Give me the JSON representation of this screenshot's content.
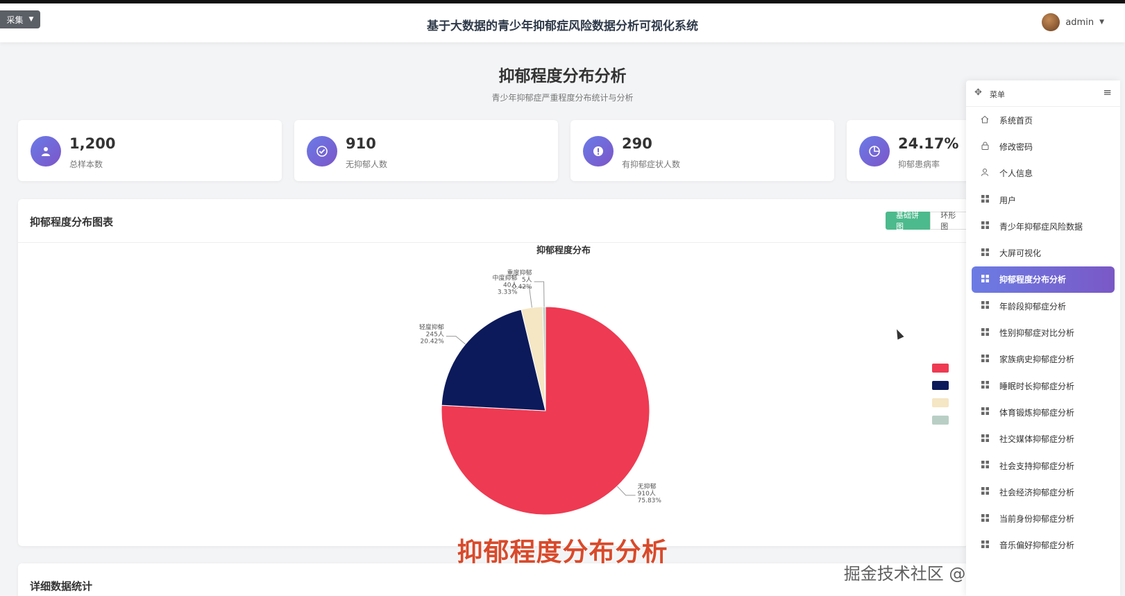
{
  "header": {
    "collect_label": "采集",
    "title": "基于大数据的青少年抑郁症风险数据分析可视化系统",
    "username": "admin"
  },
  "page": {
    "title": "抑郁程度分布分析",
    "subtitle": "青少年抑郁症严重程度分布统计与分析"
  },
  "stats": [
    {
      "value": "1,200",
      "label": "总样本数",
      "icon": "user-icon"
    },
    {
      "value": "910",
      "label": "无抑郁人数",
      "icon": "check-icon"
    },
    {
      "value": "290",
      "label": "有抑郁症状人数",
      "icon": "alert-icon"
    },
    {
      "value": "24.17%",
      "label": "抑郁患病率",
      "icon": "pie-icon"
    }
  ],
  "chart_panel": {
    "title": "抑郁程度分布图表",
    "tabs": [
      "基础饼图",
      "环形图"
    ],
    "active_tab": "基础饼图"
  },
  "chart_data": {
    "type": "pie",
    "title": "抑郁程度分布",
    "slices": [
      {
        "name": "无抑郁",
        "count_label": "910人",
        "percent_label": "75.83%",
        "value": 910,
        "color": "#ee3a52"
      },
      {
        "name": "轻度抑郁",
        "count_label": "245人",
        "percent_label": "20.42%",
        "value": 245,
        "color": "#0c1a5b"
      },
      {
        "name": "中度抑郁",
        "count_label": "40人",
        "percent_label": "3.33%",
        "value": 40,
        "color": "#f5e6c4"
      },
      {
        "name": "重度抑郁",
        "count_label": "5人",
        "percent_label": "0.42%",
        "value": 5,
        "color": "#b9cfc5"
      }
    ]
  },
  "detail_panel": {
    "title": "详细数据统计"
  },
  "caption": "抑郁程度分布分析",
  "watermark": "掘金技术社区 @ 计算机编程指导师",
  "menu": {
    "title": "菜单",
    "items": [
      {
        "label": "系统首页",
        "icon": "home-icon"
      },
      {
        "label": "修改密码",
        "icon": "lock-icon"
      },
      {
        "label": "个人信息",
        "icon": "person-icon"
      },
      {
        "label": "用户",
        "icon": "grid-icon"
      },
      {
        "label": "青少年抑郁症风险数据",
        "icon": "grid-icon"
      },
      {
        "label": "大屏可视化",
        "icon": "grid-icon"
      },
      {
        "label": "抑郁程度分布分析",
        "icon": "grid-icon",
        "active": true
      },
      {
        "label": "年龄段抑郁症分析",
        "icon": "grid-icon"
      },
      {
        "label": "性别抑郁症对比分析",
        "icon": "grid-icon"
      },
      {
        "label": "家族病史抑郁症分析",
        "icon": "grid-icon"
      },
      {
        "label": "睡眠时长抑郁症分析",
        "icon": "grid-icon"
      },
      {
        "label": "体育锻炼抑郁症分析",
        "icon": "grid-icon"
      },
      {
        "label": "社交媒体抑郁症分析",
        "icon": "grid-icon"
      },
      {
        "label": "社会支持抑郁症分析",
        "icon": "grid-icon"
      },
      {
        "label": "社会经济抑郁症分析",
        "icon": "grid-icon"
      },
      {
        "label": "当前身份抑郁症分析",
        "icon": "grid-icon"
      },
      {
        "label": "音乐偏好抑郁症分析",
        "icon": "grid-icon"
      }
    ]
  }
}
